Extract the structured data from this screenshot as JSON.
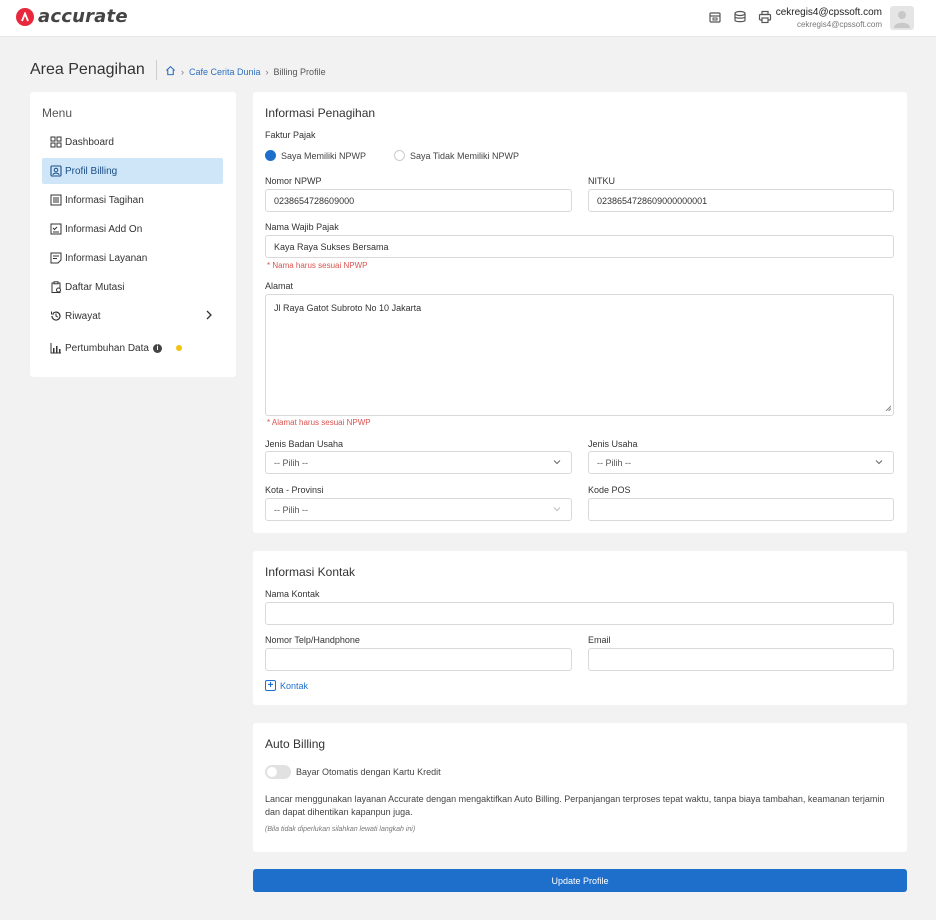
{
  "header": {
    "logo_text": "accurate",
    "user_email": "cekregis4@cpssoft.com",
    "user_sub": "cekregis4@cpssoft.com",
    "icons": [
      "store-icon",
      "database-icon",
      "print-icon"
    ]
  },
  "page": {
    "title": "Area Penagihan",
    "breadcrumb": {
      "link": "Cafe Cerita Dunia",
      "current": "Billing Profile"
    }
  },
  "sidebar": {
    "title": "Menu",
    "items": [
      {
        "label": "Dashboard",
        "icon": "dashboard-icon"
      },
      {
        "label": "Profil Billing",
        "icon": "profile-icon",
        "active": true
      },
      {
        "label": "Informasi Tagihan",
        "icon": "invoice-icon"
      },
      {
        "label": "Informasi Add On",
        "icon": "addon-icon"
      },
      {
        "label": "Informasi Layanan",
        "icon": "service-icon"
      },
      {
        "label": "Daftar Mutasi",
        "icon": "mutation-icon"
      },
      {
        "label": "Riwayat",
        "icon": "history-icon"
      },
      {
        "label": "Pertumbuhan Data",
        "icon": "chart-icon",
        "badge": "i"
      }
    ]
  },
  "billing": {
    "title": "Informasi Penagihan",
    "faktur_label": "Faktur Pajak",
    "radio_yes": "Saya Memiliki NPWP",
    "radio_no": "Saya Tidak Memiliki NPWP",
    "npwp_label": "Nomor NPWP",
    "npwp_value": "0238654728609000",
    "nitku_label": "NITKU",
    "nitku_value": "0238654728609000000001",
    "wp_label": "Nama Wajib Pajak",
    "wp_value": "Kaya Raya Sukses Bersama",
    "wp_hint": "* Nama harus sesuai NPWP",
    "alamat_label": "Alamat",
    "alamat_value": "Jl Raya Gatot Subroto No 10 Jakarta",
    "alamat_hint": "* Alamat harus sesuai NPWP",
    "badan_label": "Jenis Badan Usaha",
    "badan_value": "-- Pilih --",
    "usaha_label": "Jenis Usaha",
    "usaha_value": "-- Pilih --",
    "kota_label": "Kota - Provinsi",
    "kota_value": "-- Pilih --",
    "pos_label": "Kode POS",
    "pos_value": ""
  },
  "contact": {
    "title": "Informasi Kontak",
    "name_label": "Nama Kontak",
    "name_value": "",
    "phone_label": "Nomor Telp/Handphone",
    "phone_value": "",
    "email_label": "Email",
    "email_value": "",
    "add_label": "Kontak"
  },
  "auto_billing": {
    "title": "Auto Billing",
    "toggle_label": "Bayar Otomatis dengan Kartu Kredit",
    "toggle_on": false,
    "description": "Lancar menggunakan layanan Accurate dengan mengaktifkan Auto Billing. Perpanjangan terproses tepat waktu, tanpa biaya tambahan, keamanan terjamin dan dapat dihentikan kapanpun juga.",
    "note": "(Bila tidak diperlukan silahkan lewati langkah ini)"
  },
  "actions": {
    "update_label": "Update Profile"
  },
  "colors": {
    "primary": "#1e6fcc",
    "brand": "#e8283c",
    "active_bg": "#cfe6f9",
    "warning": "#d9534f"
  }
}
